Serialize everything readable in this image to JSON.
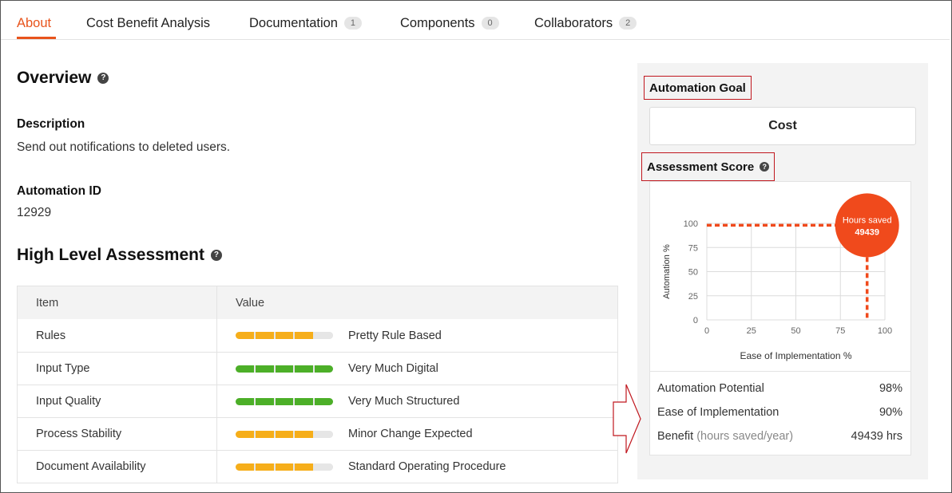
{
  "tabs": [
    {
      "label": "About",
      "active": true
    },
    {
      "label": "Cost Benefit Analysis"
    },
    {
      "label": "Documentation",
      "badge": "1"
    },
    {
      "label": "Components",
      "badge": "0"
    },
    {
      "label": "Collaborators",
      "badge": "2"
    }
  ],
  "overview": {
    "title": "Overview",
    "description_label": "Description",
    "description": "Send out notifications to deleted users.",
    "automation_id_label": "Automation ID",
    "automation_id": "12929"
  },
  "assessment": {
    "title": "High Level Assessment",
    "headers": [
      "Item",
      "Value"
    ],
    "rows": [
      {
        "item": "Rules",
        "value": "Pretty Rule Based",
        "level": 4,
        "color": "#f6ae1a"
      },
      {
        "item": "Input Type",
        "value": "Very Much Digital",
        "level": 5,
        "color": "#4caf28"
      },
      {
        "item": "Input Quality",
        "value": "Very Much Structured",
        "level": 5,
        "color": "#4caf28"
      },
      {
        "item": "Process Stability",
        "value": "Minor Change Expected",
        "level": 4,
        "color": "#f6ae1a"
      },
      {
        "item": "Document Availability",
        "value": "Standard Operating Procedure",
        "level": 4,
        "color": "#f6ae1a"
      }
    ]
  },
  "goal": {
    "label": "Automation Goal",
    "value": "Cost"
  },
  "score": {
    "label": "Assessment Score"
  },
  "chart_data": {
    "type": "scatter",
    "xlabel": "Ease of Implementation %",
    "ylabel": "Automation %",
    "xlim": [
      0,
      100
    ],
    "ylim": [
      0,
      100
    ],
    "x_ticks": [
      "0",
      "25",
      "50",
      "75",
      "100"
    ],
    "y_ticks": [
      "0",
      "25",
      "50",
      "75",
      "100"
    ],
    "grid": true,
    "point": {
      "x": 90,
      "y": 98,
      "label": "Hours saved",
      "value": "49439"
    },
    "accent": "#f04a1c"
  },
  "metrics": [
    {
      "label": "Automation Potential",
      "value": "98%"
    },
    {
      "label": "Ease of Implementation",
      "value": "90%"
    },
    {
      "label": "Benefit",
      "sub": "(hours saved/year)",
      "value": "49439 hrs"
    }
  ]
}
